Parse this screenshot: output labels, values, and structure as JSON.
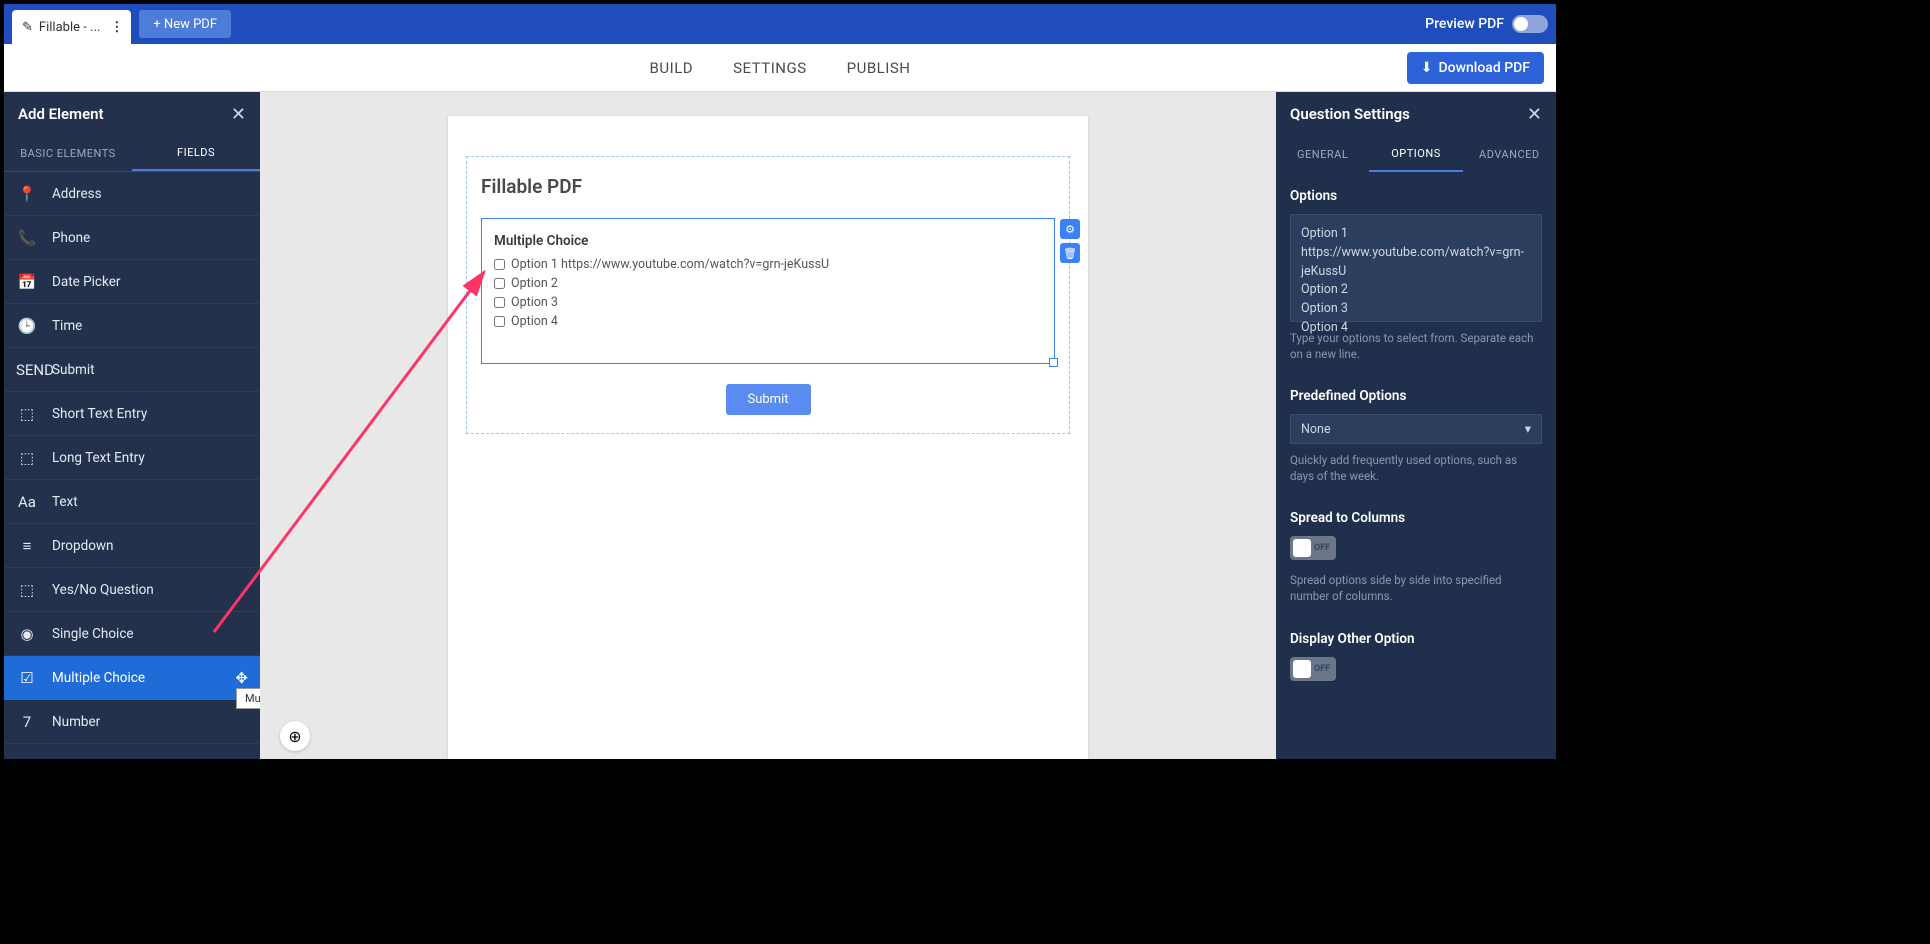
{
  "topbar": {
    "tab_label": "Fillable - ...",
    "new_pdf": "+ New PDF",
    "preview": "Preview PDF"
  },
  "navbar": {
    "build": "BUILD",
    "settings": "SETTINGS",
    "publish": "PUBLISH",
    "download": "Download PDF"
  },
  "left_panel": {
    "title": "Add Element",
    "tab_basic": "BASIC ELEMENTS",
    "tab_fields": "FIELDS",
    "fields": [
      "Address",
      "Phone",
      "Date Picker",
      "Time",
      "Submit",
      "Short Text Entry",
      "Long Text Entry",
      "Text",
      "Dropdown",
      "Yes/No Question",
      "Single Choice",
      "Multiple Choice",
      "Number"
    ],
    "active_index": 11,
    "tooltip": "Multiple Choice"
  },
  "canvas": {
    "doc_title": "Fillable PDF",
    "mc_title": "Multiple Choice",
    "options": [
      "Option 1 https://www.youtube.com/watch?v=grn-jeKussU",
      "Option 2",
      "Option 3",
      "Option 4"
    ],
    "submit": "Submit"
  },
  "right_panel": {
    "title": "Question Settings",
    "tab_general": "GENERAL",
    "tab_options": "OPTIONS",
    "tab_advanced": "ADVANCED",
    "options_label": "Options",
    "options_text": "Option 1 https://www.youtube.com/watch?v=grn-jeKussU\nOption 2\nOption 3\nOption 4",
    "options_hint": "Type your options to select from. Separate each on a new line.",
    "predefined_label": "Predefined Options",
    "predefined_value": "None",
    "predefined_hint": "Quickly add frequently used options, such as days of the week.",
    "spread_label": "Spread to Columns",
    "spread_state": "OFF",
    "spread_hint": "Spread options side by side into specified number of columns.",
    "other_label": "Display Other Option",
    "other_state": "OFF"
  },
  "icons": {
    "fields": [
      "📍",
      "📞",
      "📅",
      "🕒",
      "SEND",
      "⬚",
      "⬚",
      "Aa",
      "≡",
      "⬚",
      "◉",
      "☑",
      "7"
    ]
  }
}
